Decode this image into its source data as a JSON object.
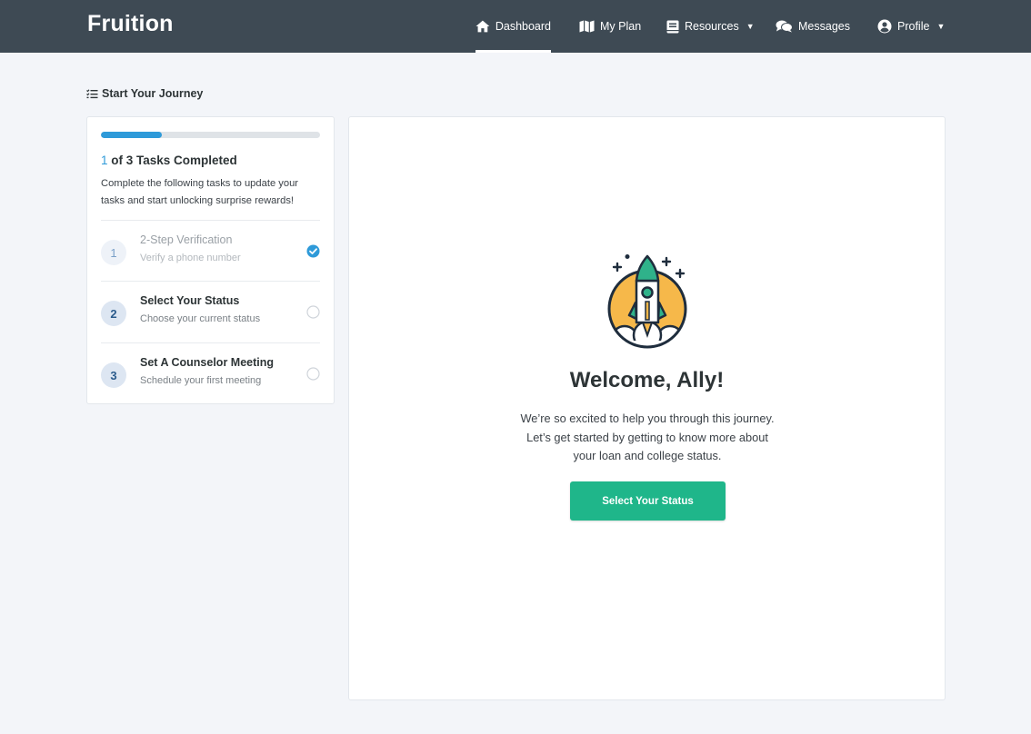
{
  "header": {
    "brand": "Fruition",
    "nav": [
      {
        "label": "Dashboard",
        "icon": "home-icon",
        "active": true
      },
      {
        "label": "My Plan",
        "icon": "map-icon"
      },
      {
        "label": "Resources",
        "icon": "book-icon",
        "caret": "▼"
      },
      {
        "label": "Messages",
        "icon": "chat-icon"
      },
      {
        "label": "Profile",
        "icon": "user-circle-icon",
        "caret": "▼"
      }
    ]
  },
  "journey": {
    "title": "Start Your Journey",
    "title_icon": "checklist-icon",
    "progress_fraction": 0.28,
    "completed_count": "1",
    "completed_suffix": " of 3 Tasks Completed",
    "description": "Complete the following tasks to update your tasks and start unlocking surprise rewards!",
    "tasks": [
      {
        "number": "1",
        "title": "2-Step Verification",
        "subtitle": "Verify a phone number",
        "completed": true
      },
      {
        "number": "2",
        "title": "Select Your Status",
        "subtitle": "Choose your current status",
        "completed": false
      },
      {
        "number": "3",
        "title": "Set A Counselor Meeting",
        "subtitle": "Schedule your first meeting",
        "completed": false
      }
    ]
  },
  "welcome": {
    "illustration": "rocket-icon",
    "heading": "Welcome, Ally!",
    "body": "We’re so excited to help you through this journey. Let’s get started by getting to know more about your loan and college status.",
    "cta_label": "Select Your Status"
  },
  "colors": {
    "topbar": "#3e4a54",
    "accent_blue": "#2e9ad9",
    "cta_green": "#1fb68a",
    "rocket_orange": "#f6b84a",
    "rocket_teal": "#2fb28a",
    "rocket_navy": "#1f2d3d"
  }
}
